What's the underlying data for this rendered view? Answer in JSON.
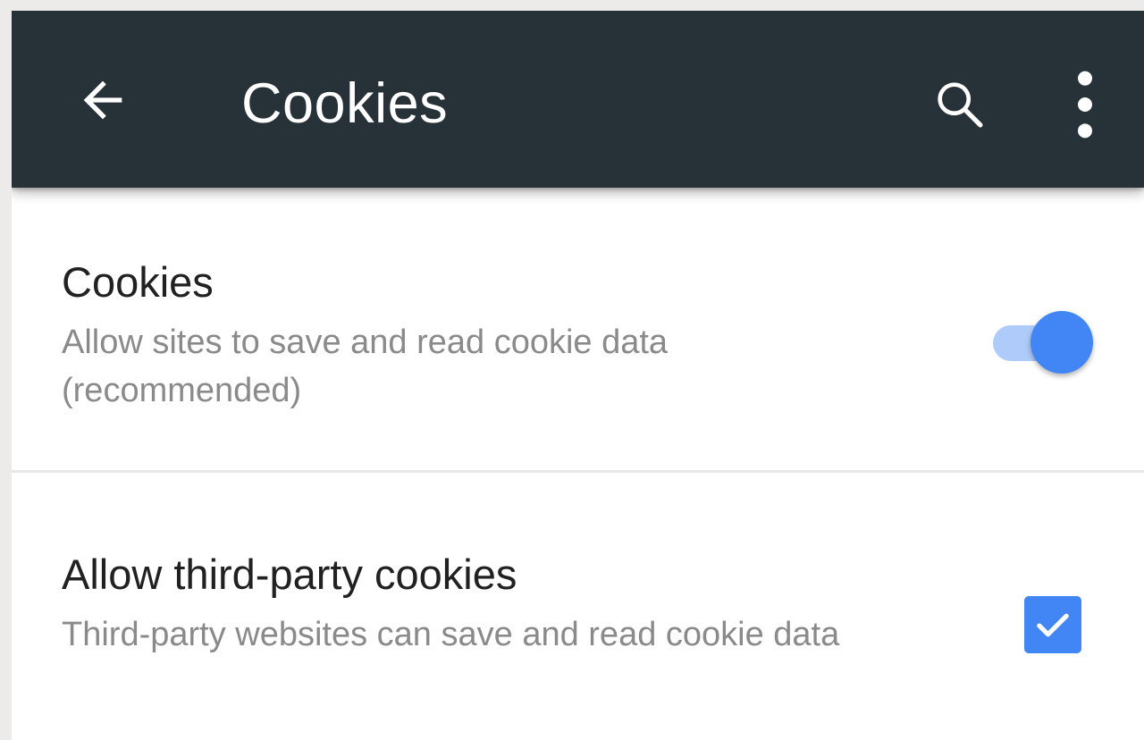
{
  "toolbar": {
    "title": "Cookies",
    "back_icon": "arrow-left-icon",
    "search_icon": "search-icon",
    "more_icon": "more-vert-icon",
    "background_color": "#263238"
  },
  "settings": {
    "cookies": {
      "title": "Cookies",
      "summary": "Allow sites to save and read cookie data (recommended)",
      "enabled": true,
      "control": "toggle-switch"
    },
    "third_party": {
      "title": "Allow third-party cookies",
      "summary": "Third-party websites can save and read cookie data",
      "checked": true,
      "control": "checkbox"
    }
  },
  "colors": {
    "accent": "#4285f4",
    "track_on": "#aecbfa",
    "title_text": "#212121",
    "summary_text": "#8a8a8a"
  }
}
